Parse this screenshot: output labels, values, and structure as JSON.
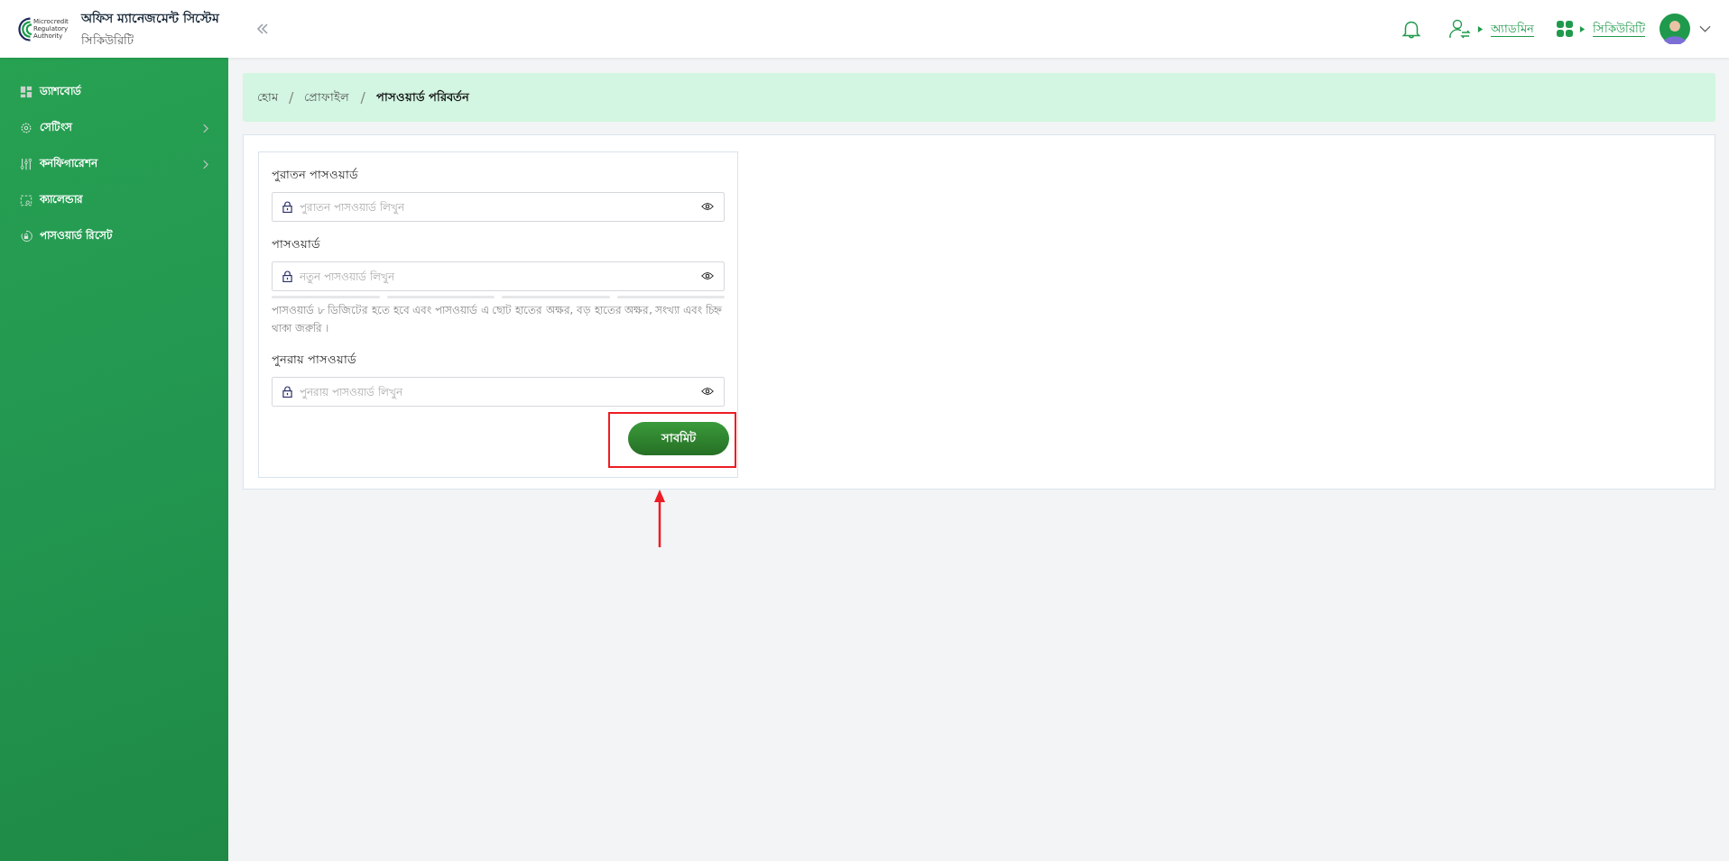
{
  "header": {
    "logo_text": [
      "Microcredit",
      "Regulatory",
      "Authority"
    ],
    "title": "অফিস ম্যানেজমেন্ট সিস্টেম",
    "subtitle": "সিকিউরিটি",
    "role_link": "অ্যাডমিন",
    "module_link": "সিকিউরিটি"
  },
  "sidebar": {
    "items": [
      {
        "label": "ড্যাশবোর্ড",
        "has_submenu": false
      },
      {
        "label": "সেটিংস",
        "has_submenu": true
      },
      {
        "label": "কনফিগারেশন",
        "has_submenu": true
      },
      {
        "label": "ক্যালেন্ডার",
        "has_submenu": false
      },
      {
        "label": "পাসওয়ার্ড রিসেট",
        "has_submenu": false
      }
    ]
  },
  "breadcrumb": {
    "separator": "/",
    "items": [
      {
        "label": "হোম",
        "selected": false
      },
      {
        "label": "প্রোফাইল",
        "selected": false
      },
      {
        "label": "পাসওয়ার্ড পরিবর্তন",
        "selected": true
      }
    ]
  },
  "form": {
    "fields": [
      {
        "label": "পুরাতন পাসওয়ার্ড",
        "placeholder": "পুরাতন পাসওয়ার্ড লিখুন"
      },
      {
        "label": "পাসওয়ার্ড",
        "placeholder": "নতুন পাসওয়ার্ড লিখুন",
        "hint": "পাসওয়ার্ড ৮ ডিজিটের হতে হবে এবং পাসওয়ার্ড এ ছোট হাতের অক্ষর, বড় হাতের অক্ষর, সংখ্যা এবং চিহ্ন থাকা জরুরি ।"
      },
      {
        "label": "পুনরায় পাসওয়ার্ড",
        "placeholder": "পুনরায় পাসওয়ার্ড লিখুন"
      }
    ],
    "submit": "সাবমিট"
  }
}
